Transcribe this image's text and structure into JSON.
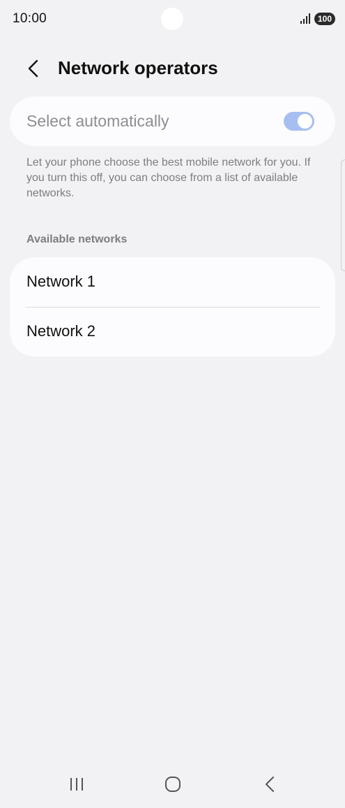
{
  "status_bar": {
    "time": "10:00",
    "battery": "100"
  },
  "header": {
    "title": "Network operators"
  },
  "auto_select": {
    "label": "Select automatically",
    "enabled": true,
    "description": "Let your phone choose the best mobile network for you. If you turn this off, you can choose from a list of available networks."
  },
  "networks": {
    "section_title": "Available networks",
    "items": [
      {
        "label": "Network 1"
      },
      {
        "label": "Network 2"
      }
    ]
  },
  "colors": {
    "background": "#f2f2f4",
    "card": "#fcfcfe",
    "toggle_on_disabled": "#a7bff0",
    "muted_text": "#7d7d82"
  },
  "icons": {
    "back": "chevron-left-icon",
    "signal": "signal-icon",
    "nav_recent": "recent-apps-icon",
    "nav_home": "home-icon",
    "nav_back": "back-icon"
  }
}
